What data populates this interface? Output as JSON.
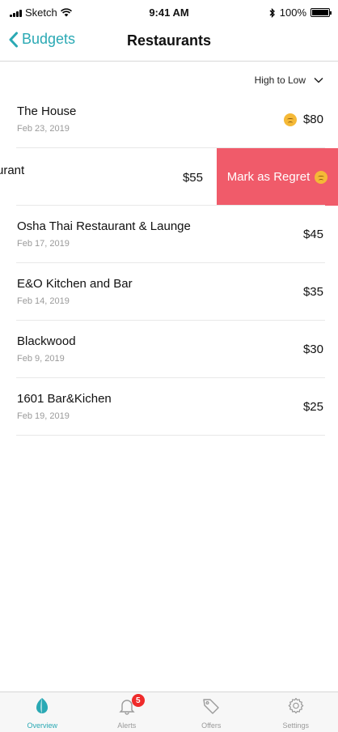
{
  "status_bar": {
    "carrier": "Sketch",
    "time": "9:41 AM",
    "battery": "100%"
  },
  "nav": {
    "back_label": "Budgets",
    "title": "Restaurants"
  },
  "sort": {
    "label": "High to Low"
  },
  "transactions": [
    {
      "name": "The House",
      "date": "Feb 23, 2019",
      "amount": "$80",
      "regret": true
    },
    {
      "name": "urant",
      "amount": "$55",
      "swiped": true
    },
    {
      "name": "Osha Thai Restaurant & Launge",
      "date": "Feb 17, 2019",
      "amount": "$45"
    },
    {
      "name": "E&O Kitchen and Bar",
      "date": "Feb 14, 2019",
      "amount": "$35"
    },
    {
      "name": "Blackwood",
      "date": "Feb 9, 2019",
      "amount": "$30"
    },
    {
      "name": "1601 Bar&Kichen",
      "date": "Feb 19, 2019",
      "amount": "$25"
    }
  ],
  "swipe_action": {
    "label": "Mark as Regret"
  },
  "tabs": [
    {
      "label": "Overview",
      "icon": "overview-icon",
      "active": true
    },
    {
      "label": "Alerts",
      "icon": "bell-icon",
      "badge": "5"
    },
    {
      "label": "Offers",
      "icon": "tag-icon"
    },
    {
      "label": "Settings",
      "icon": "gear-icon"
    }
  ],
  "colors": {
    "accent": "#2aa9b4",
    "regret": "#f05b6a",
    "badge": "#ef2b2b"
  }
}
